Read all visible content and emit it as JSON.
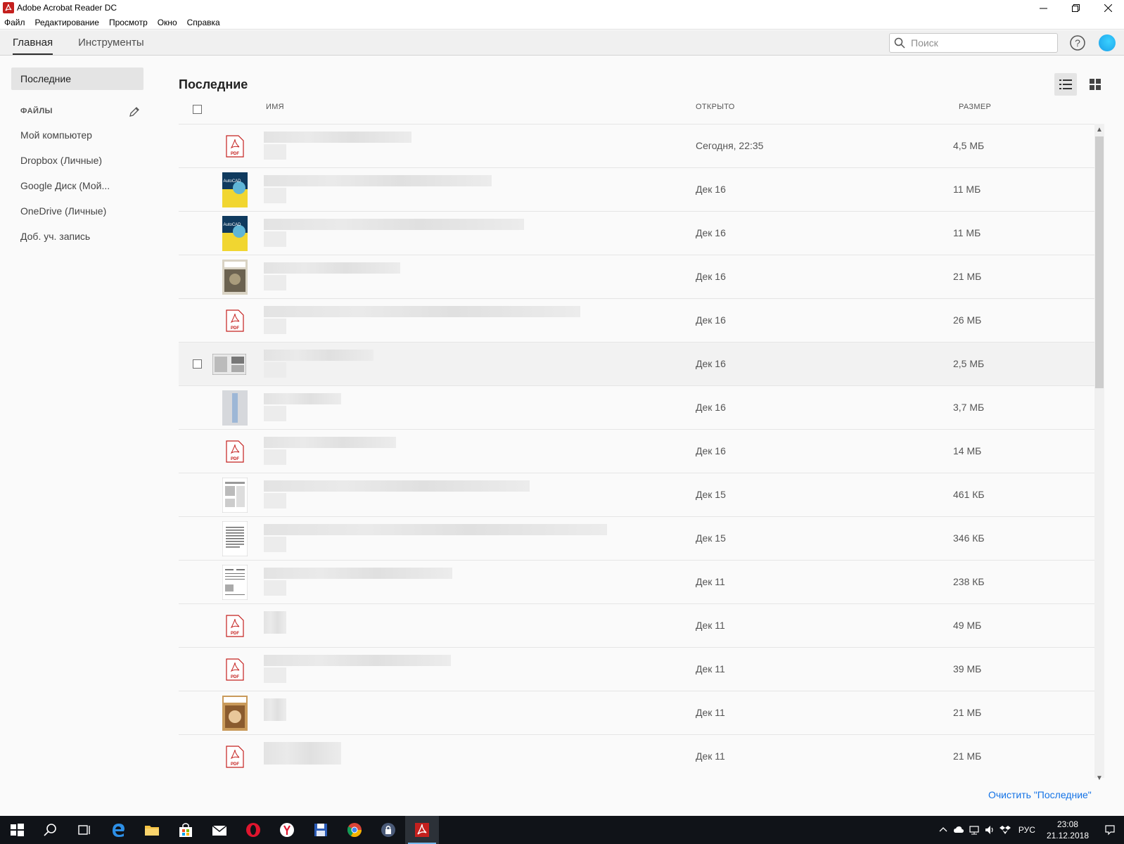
{
  "window": {
    "title": "Adobe Acrobat Reader DC"
  },
  "menu": [
    "Файл",
    "Редактирование",
    "Просмотр",
    "Окно",
    "Справка"
  ],
  "tabs": {
    "home": "Главная",
    "tools": "Инструменты"
  },
  "search": {
    "placeholder": "Поиск"
  },
  "sidebar": {
    "recent": "Последние",
    "files_header": "ФАЙЛЫ",
    "items": [
      "Мой компьютер",
      "Dropbox (Личные)",
      "Google Диск (Мой...",
      "OneDrive (Личные)",
      "Доб. уч. запись"
    ]
  },
  "main": {
    "title": "Последние",
    "columns": {
      "name": "ИМЯ",
      "opened": "ОТКРЫТО",
      "size": "РАЗМЕР"
    },
    "rows": [
      {
        "thumb": "pdf-icon",
        "opened": "Сегодня, 22:35",
        "size": "4,5 МБ"
      },
      {
        "thumb": "autocad-book-icon",
        "opened": "Дек 16",
        "size": "11 МБ"
      },
      {
        "thumb": "autocad-book-icon",
        "opened": "Дек 16",
        "size": "11 МБ"
      },
      {
        "thumb": "magazine-cover-icon",
        "opened": "Дек 16",
        "size": "21 МБ"
      },
      {
        "thumb": "pdf-icon",
        "opened": "Дек 16",
        "size": "26 МБ"
      },
      {
        "thumb": "document-spread-icon",
        "opened": "Дек 16",
        "size": "2,5 МБ"
      },
      {
        "thumb": "blue-document-icon",
        "opened": "Дек 16",
        "size": "3,7 МБ"
      },
      {
        "thumb": "pdf-icon",
        "opened": "Дек 16",
        "size": "14 МБ"
      },
      {
        "thumb": "document-page-icon",
        "opened": "Дек 15",
        "size": "461 КБ"
      },
      {
        "thumb": "text-page-icon",
        "opened": "Дек 15",
        "size": "346 КБ"
      },
      {
        "thumb": "table-page-icon",
        "opened": "Дек 11",
        "size": "238 КБ"
      },
      {
        "thumb": "pdf-icon",
        "opened": "Дек 11",
        "size": "49 МБ"
      },
      {
        "thumb": "pdf-icon",
        "opened": "Дек 11",
        "size": "39 МБ"
      },
      {
        "thumb": "magazine-cover-icon",
        "opened": "Дек 11",
        "size": "21 МБ"
      },
      {
        "thumb": "pdf-icon",
        "opened": "Дек 11",
        "size": "21 МБ"
      }
    ],
    "clear_link": "Очистить \"Последние\""
  },
  "taskbar": {
    "language": "РУС",
    "time": "23:08",
    "date": "21.12.2018"
  },
  "colors": {
    "accent": "#1473e6",
    "pdf_red": "#c4201e"
  }
}
